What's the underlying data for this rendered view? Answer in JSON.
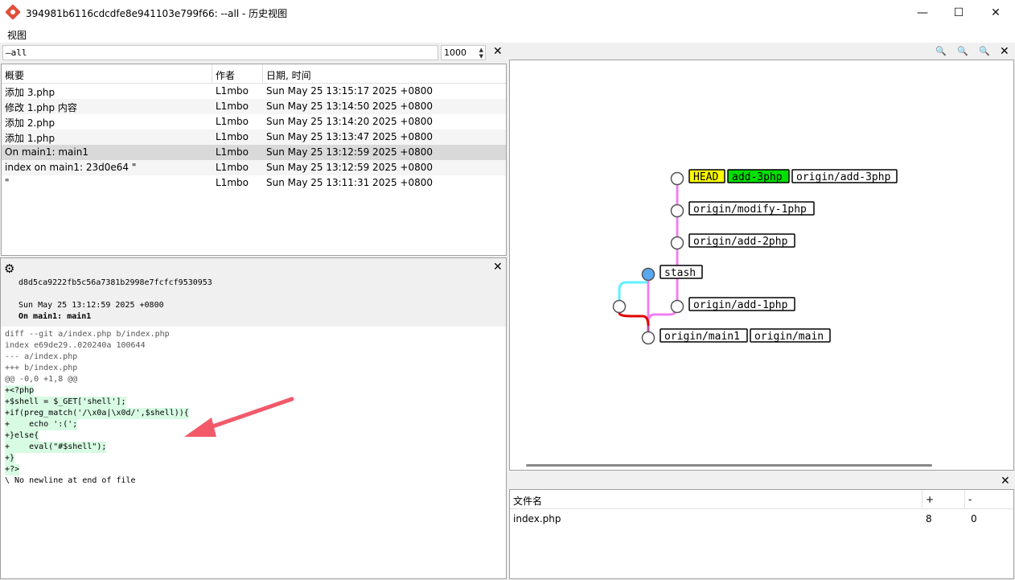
{
  "window": {
    "title": "394981b6116cdcdfe8e941103e799f66: --all - 历史视图",
    "minimize": "—",
    "maximize": "☐",
    "close": "✕"
  },
  "menu": {
    "view": "视图"
  },
  "search": {
    "value": "—all",
    "max_count": "1000"
  },
  "commit_table": {
    "headers": {
      "summary": "概要",
      "author": "作者",
      "date": "日期, 时间"
    },
    "rows": [
      {
        "summary": "添加 3.php",
        "author": "L1mbo",
        "date": "Sun May 25 13:15:17 2025 +0800"
      },
      {
        "summary": "修改 1.php 内容",
        "author": "L1mbo",
        "date": "Sun May 25 13:14:50 2025 +0800"
      },
      {
        "summary": "添加 2.php",
        "author": "L1mbo",
        "date": "Sun May 25 13:14:20 2025 +0800"
      },
      {
        "summary": "添加 1.php",
        "author": "L1mbo",
        "date": "Sun May 25 13:13:47 2025 +0800"
      },
      {
        "summary": "On main1: main1",
        "author": "L1mbo",
        "date": "Sun May 25 13:12:59 2025 +0800"
      },
      {
        "summary": "index on main1: 23d0e64 \"",
        "author": "L1mbo",
        "date": "Sun May 25 13:12:59 2025 +0800"
      },
      {
        "summary": " \"",
        "author": "L1mbo",
        "date": "Sun May 25 13:11:31 2025 +0800"
      }
    ],
    "selected_index": 4
  },
  "detail": {
    "hash": "d8d5ca9222fb5c56a7381b2998e7fcfcf9530953",
    "date": "Sun May 25 13:12:59 2025 +0800",
    "message": "On main1: main1",
    "diff": [
      {
        "text": "diff --git a/index.php b/index.php",
        "kind": "meta"
      },
      {
        "text": "index e69de29..020240a 100644",
        "kind": "meta"
      },
      {
        "text": "--- a/index.php",
        "kind": "meta"
      },
      {
        "text": "+++ b/index.php",
        "kind": "meta"
      },
      {
        "text": "@@ -0,0 +1,8 @@",
        "kind": "hunk"
      },
      {
        "text": "+<?php",
        "kind": "add"
      },
      {
        "text": "+$shell = $_GET['shell'];",
        "kind": "add"
      },
      {
        "text": "+if(preg_match('/\\x0a|\\x0d/',$shell)){",
        "kind": "add"
      },
      {
        "text": "+    echo ':(';",
        "kind": "add"
      },
      {
        "text": "+}else{",
        "kind": "add"
      },
      {
        "text": "+    eval(\"#$shell\");",
        "kind": "add"
      },
      {
        "text": "+}",
        "kind": "add"
      },
      {
        "text": "+?>",
        "kind": "add"
      },
      {
        "text": "\\ No newline at end of file",
        "kind": "plain"
      }
    ]
  },
  "graph": {
    "refs": {
      "head": "HEAD",
      "add3": "add-3php",
      "origin_add3": "origin/add-3php",
      "origin_modify1": "origin/modify-1php",
      "origin_add2": "origin/add-2php",
      "stash": "stash",
      "origin_add1": "origin/add-1php",
      "origin_main1": "origin/main1",
      "origin_main": "origin/main"
    },
    "colors": {
      "head_bg": "#ffff00",
      "branch_bg": "#00e000",
      "stash_node": "#5aa9f0",
      "line_pink": "#f080f0",
      "line_cyan": "#60f0ff",
      "line_red": "#e00000"
    }
  },
  "files": {
    "headers": {
      "name": "文件名",
      "added": "+",
      "removed": "-"
    },
    "rows": [
      {
        "name": "index.php",
        "added": "8",
        "removed": "0"
      }
    ]
  },
  "annotation": {
    "arrow_color": "#f25a6a"
  }
}
